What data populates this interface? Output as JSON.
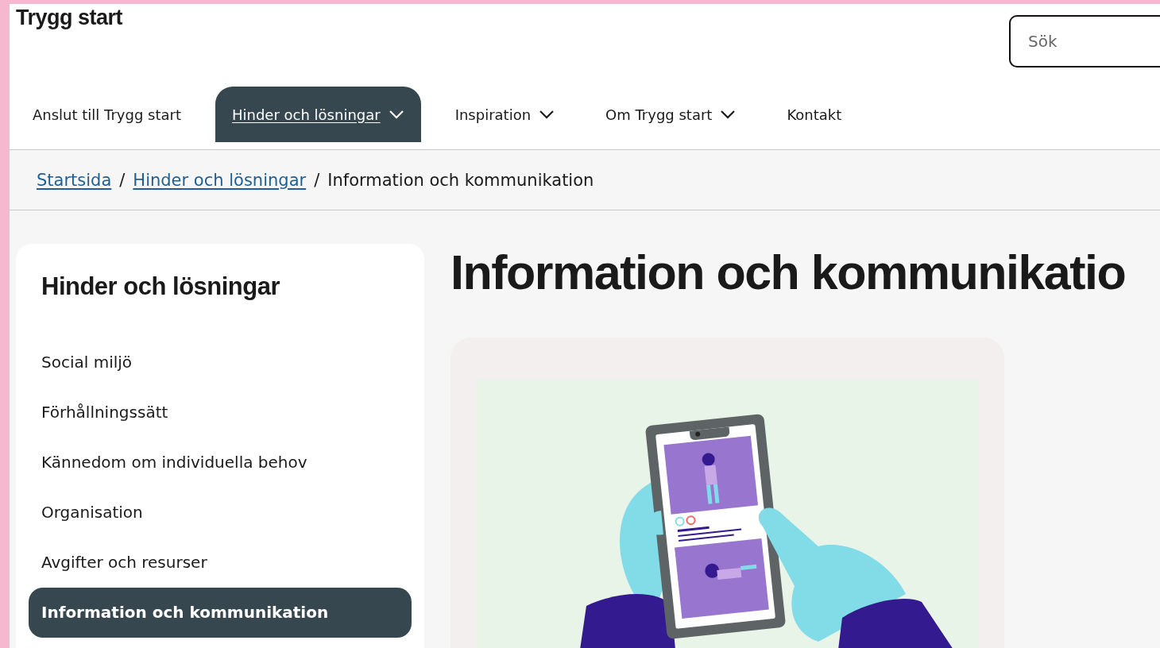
{
  "site": {
    "logo": "Trygg start"
  },
  "search": {
    "placeholder": "Sök"
  },
  "nav": [
    {
      "label": "Anslut till Trygg start",
      "selected": false,
      "dropdown": false
    },
    {
      "label": "Hinder och lösningar",
      "selected": true,
      "dropdown": true
    },
    {
      "label": "Inspiration",
      "selected": false,
      "dropdown": true
    },
    {
      "label": "Om Trygg start",
      "selected": false,
      "dropdown": true
    },
    {
      "label": "Kontakt",
      "selected": false,
      "dropdown": false
    }
  ],
  "breadcrumb": [
    {
      "label": "Startsida",
      "kind": "link"
    },
    {
      "separator": "/",
      "label": "Hinder och lösningar",
      "kind": "link"
    },
    {
      "separator": "/",
      "label": "Information och kommunikation",
      "kind": "current"
    }
  ],
  "sidebar": {
    "title": "Hinder och lösningar",
    "items": [
      {
        "label": "Social miljö",
        "selected": false
      },
      {
        "label": "Förhållningssätt",
        "selected": false
      },
      {
        "label": "Kännedom om individuella behov",
        "selected": false
      },
      {
        "label": "Organisation",
        "selected": false
      },
      {
        "label": "Avgifter och resurser",
        "selected": false
      },
      {
        "label": "Information och kommunikation",
        "selected": true
      }
    ]
  },
  "page": {
    "title": "Information och kommunikatio"
  }
}
